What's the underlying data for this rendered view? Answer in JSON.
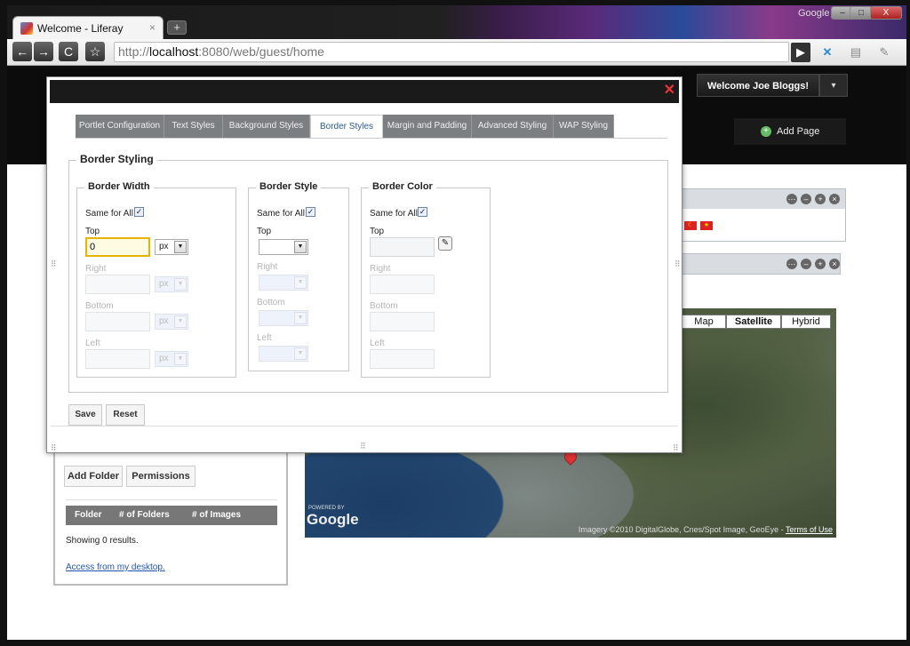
{
  "browser": {
    "tab_title": "Welcome - Liferay",
    "tab_close": "×",
    "new_tab": "+",
    "brand": "Google",
    "url_prefix": "http://",
    "url_host": "localhost",
    "url_rest": ":8080/web/guest/home",
    "nav_back": "←",
    "nav_forward": "→",
    "reload": "C",
    "star": "☆",
    "win_min": "–",
    "win_max": "□",
    "win_close": "X"
  },
  "header": {
    "welcome": "Welcome Joe Bloggs!",
    "welcome_toggle": "▾",
    "add_page": "Add Page"
  },
  "dialog": {
    "close": "✕",
    "tabs": [
      {
        "label": "Portlet Configuration"
      },
      {
        "label": "Text Styles"
      },
      {
        "label": "Background Styles"
      },
      {
        "label": "Border Styles"
      },
      {
        "label": "Margin and Padding"
      },
      {
        "label": "Advanced Styling"
      },
      {
        "label": "WAP Styling"
      }
    ],
    "active_tab": "Border Styles",
    "border_styling": {
      "legend": "Border Styling",
      "width": {
        "legend": "Border Width",
        "same_for_all": "Same for All",
        "same_checked": "✓",
        "top": "Top",
        "top_value": "0",
        "top_unit": "px",
        "right": "Right",
        "right_unit": "px",
        "bottom": "Bottom",
        "bottom_unit": "px",
        "left": "Left",
        "left_unit": "px"
      },
      "style": {
        "legend": "Border Style",
        "same_for_all": "Same for All",
        "same_checked": "✓",
        "top": "Top",
        "right": "Right",
        "bottom": "Bottom",
        "left": "Left"
      },
      "color": {
        "legend": "Border Color",
        "same_for_all": "Same for All",
        "same_checked": "✓",
        "top": "Top",
        "right": "Right",
        "bottom": "Bottom",
        "left": "Left"
      }
    },
    "save": "Save",
    "reset": "Reset"
  },
  "map": {
    "types": [
      {
        "label": "Map"
      },
      {
        "label": "Satellite"
      },
      {
        "label": "Hybrid"
      }
    ],
    "selected_type": "Satellite",
    "powered_by": "POWERED BY",
    "google_logo": "Google",
    "attribution": "Imagery ©2010 DigitalGlobe, Cnes/Spot Image, GeoEye - ",
    "terms": "Terms of Use"
  },
  "gallery": {
    "add_folder": "Add Folder",
    "permissions": "Permissions",
    "columns": [
      "Folder",
      "# of Folders",
      "# of Images"
    ],
    "showing": "Showing 0 results.",
    "access": "Access from my desktop."
  },
  "portlet_controls": [
    "⋯",
    "–",
    "+",
    "×"
  ]
}
